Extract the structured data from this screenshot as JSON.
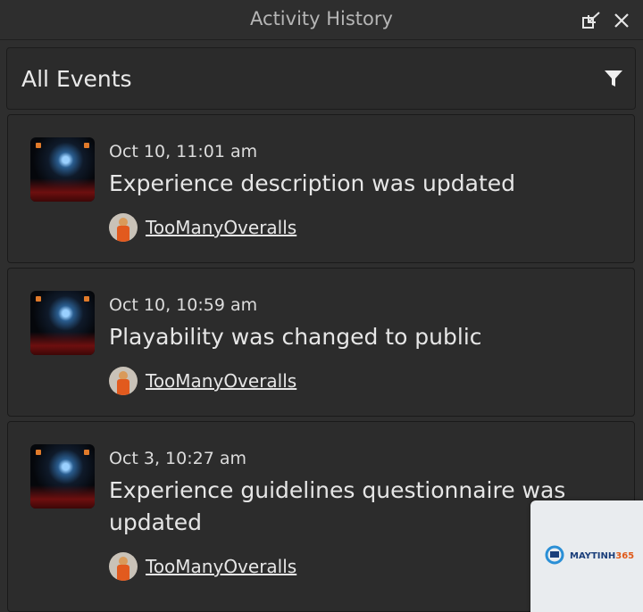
{
  "window": {
    "title": "Activity History"
  },
  "header": {
    "label": "All Events"
  },
  "events": [
    {
      "time": "Oct 10, 11:01 am",
      "description": "Experience description was updated",
      "user": "TooManyOveralls"
    },
    {
      "time": "Oct 10, 10:59 am",
      "description": "Playability was changed to public",
      "user": "TooManyOveralls"
    },
    {
      "time": "Oct 3, 10:27 am",
      "description": "Experience guidelines questionnaire was updated",
      "user": "TooManyOveralls"
    }
  ],
  "watermark": {
    "brand_main": "MAYTINH",
    "brand_accent": "365"
  },
  "icons": {
    "dock": "dock-icon",
    "close": "close-icon",
    "filter": "filter-icon"
  },
  "colors": {
    "background": "#2e2e2e",
    "card": "#2c2c2c",
    "text": "#e6e6e6",
    "muted": "#b5b5b5"
  }
}
